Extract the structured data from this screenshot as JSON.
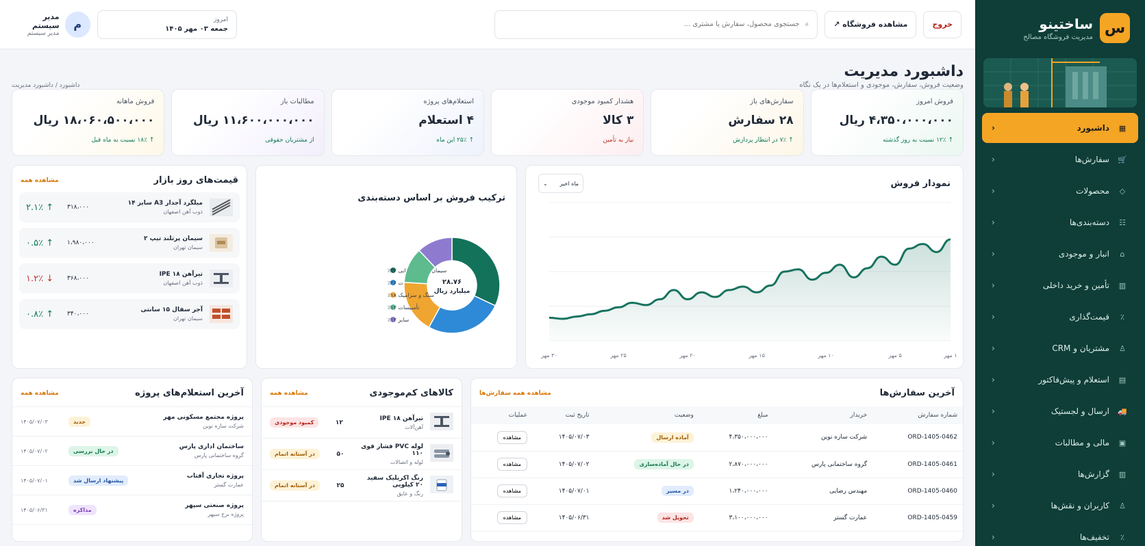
{
  "brand": {
    "logo": "س",
    "name": "ساختینو",
    "subtitle": "مدیریت فروشگاه مصالح"
  },
  "colors": {
    "primary": "#0f3d38",
    "accent": "#f5a524",
    "success": "#0f7a55",
    "danger": "#c0352b",
    "chart_line": "#17735f"
  },
  "nav": [
    {
      "label": "داشبورد",
      "icon": "grid-icon",
      "active": true
    },
    {
      "label": "سفارش‌ها",
      "icon": "cart-icon"
    },
    {
      "label": "محصولات",
      "icon": "box-icon"
    },
    {
      "label": "دسته‌بندی‌ها",
      "icon": "category-icon"
    },
    {
      "label": "انبار و موجودی",
      "icon": "warehouse-icon"
    },
    {
      "label": "تأمین و خرید داخلی",
      "icon": "supply-icon"
    },
    {
      "label": "قیمت‌گذاری",
      "icon": "percent-icon"
    },
    {
      "label": "مشتریان و CRM",
      "icon": "users-icon"
    },
    {
      "label": "استعلام و پیش‌فاکتور",
      "icon": "invoice-icon"
    },
    {
      "label": "ارسال و لجستیک",
      "icon": "truck-icon"
    },
    {
      "label": "مالی و مطالبات",
      "icon": "wallet-icon"
    },
    {
      "label": "گزارش‌ها",
      "icon": "report-icon"
    },
    {
      "label": "کاربران و نقش‌ها",
      "icon": "user-role-icon"
    },
    {
      "label": "تخفیف‌ها",
      "icon": "discount-icon"
    }
  ],
  "topbar": {
    "logout": "خروج",
    "view_store": "مشاهده فروشگاه ↗",
    "search_placeholder": "جستجوی محصول، سفارش یا مشتری ...",
    "date_label": "امروز",
    "date_value": "جمعه ۰۳ مهر ۱۴۰۵",
    "user_initial": "م",
    "user_name": "مدیر سیستم",
    "user_role": "مدیر سیستم"
  },
  "page": {
    "title": "داشبورد مدیریت",
    "subtitle": "وضعیت فروش، سفارش، موجودی و استعلام‌ها در یک نگاه",
    "breadcrumb": "داشبورد / داشبورد مدیریت"
  },
  "kpis": [
    {
      "title": "فروش امروز",
      "value": "۴،۳۵۰،۰۰۰،۰۰۰ ریال",
      "foot": "↑ ۱۲٪ نسبت به روز گذشته",
      "foot_color": "#0f7a55",
      "tint": "#eaf7f1"
    },
    {
      "title": "سفارش‌های باز",
      "value": "۲۸ سفارش",
      "foot": "↑ ۷٪ در انتظار پردازش",
      "foot_color": "#0f7a55",
      "tint": "#fdf6e6"
    },
    {
      "title": "هشدار کمبود موجودی",
      "value": "۳ کالا",
      "foot": "نیاز به تأمین",
      "foot_color": "#c0352b",
      "tint": "#fdeef0"
    },
    {
      "title": "استعلام‌های پروژه",
      "value": "۴ استعلام",
      "foot": "↑ ۲۵٪ این ماه",
      "foot_color": "#0f7a55",
      "tint": "#eef2fc"
    },
    {
      "title": "مطالبات باز",
      "value": "۱۱،۶۰۰،۰۰۰،۰۰۰ ریال",
      "foot": "از مشتریان حقوقی",
      "foot_color": "#0f7a55",
      "tint": "#f2eefc"
    },
    {
      "title": "فروش ماهانه",
      "value": "۱۸،۰۶۰،۵۰۰،۰۰۰ ریال",
      "foot": "↑ ۱۸٪ نسبت به ماه قبل",
      "foot_color": "#0f7a55",
      "tint": "#fdf8e8"
    }
  ],
  "sales_chart": {
    "title": "نمودار فروش",
    "period": "ماه اخیر"
  },
  "donut_card": {
    "title": "ترکیب فروش بر اساس دسته‌بندی",
    "center_value": "۲۸.۷۶",
    "center_unit": "میلیارد ریال"
  },
  "chart_data": [
    {
      "type": "area",
      "x": [
        "۱ مهر",
        "۲ مهر",
        "۳ مهر",
        "۴ مهر",
        "۵ مهر",
        "۶ مهر",
        "۷ مهر",
        "۸ مهر",
        "۹ مهر",
        "۱۰ مهر",
        "۱۱ مهر",
        "۱۲ مهر",
        "۱۳ مهر",
        "۱۴ مهر",
        "۱۵ مهر",
        "۱۶ مهر",
        "۱۷ مهر",
        "۱۸ مهر",
        "۱۹ مهر",
        "۲۰ مهر",
        "۲۱ مهر",
        "۲۲ مهر",
        "۲۳ مهر",
        "۲۴ مهر",
        "۲۵ مهر",
        "۲۶ مهر",
        "۲۷ مهر",
        "۲۸ مهر",
        "۲۹ مهر",
        "۳۰ مهر"
      ],
      "xticks": [
        "۱ مهر",
        "۵ مهر",
        "۱۰ مهر",
        "۱۵ مهر",
        "۲۰ مهر",
        "۲۵ مهر",
        "۳۰ مهر"
      ],
      "values": [
        6.8,
        5.7,
        6.4,
        6.0,
        4.6,
        5.3,
        4.3,
        3.5,
        4.6,
        3.9,
        3.3,
        4.2,
        4.0,
        2.8,
        2.2,
        2.7,
        2.4,
        1.8,
        2.2,
        1.6,
        2.4,
        1.6,
        1.1,
        1.3,
        0.9,
        0.6,
        0.3,
        0.1,
        -0.1,
        0.0
      ],
      "ylim": [
        -2,
        10
      ],
      "grid": true
    },
    {
      "type": "pie",
      "legend": [
        {
          "label": "سیمان و مصالح بنایی ۳۲٪",
          "value": 32,
          "color": "#13725a"
        },
        {
          "label": "آهن‌آلات ۲۶٪",
          "value": 26,
          "color": "#2e8ad6"
        },
        {
          "label": "سنگ و سرامیک ۱۸٪",
          "value": 18,
          "color": "#f0a530"
        },
        {
          "label": "تأسیسات ۱۲٪",
          "value": 12,
          "color": "#5dbb8e"
        },
        {
          "label": "سایر ۱۲٪",
          "value": 12,
          "color": "#8e7bd0"
        }
      ],
      "legend_position": "left"
    }
  ],
  "market": {
    "title": "قیمت‌های روز بازار",
    "link": "مشاهده همه",
    "items": [
      {
        "name": "میلگرد آجدار A3 سایز ۱۴",
        "supplier": "ذوب آهن اصفهان",
        "price": "۳۱۸،۰۰۰",
        "change": "↑ ۲.۱٪",
        "color": "#0f7a55",
        "thumb": "rebar-icon"
      },
      {
        "name": "سیمان پرتلند تیپ ۲",
        "supplier": "سیمان تهران",
        "price": "۱،۹۸۰،۰۰۰",
        "change": "↑ ۰.۵٪",
        "color": "#0f7a55",
        "thumb": "cement-bag-icon"
      },
      {
        "name": "تیرآهن IPE ۱۸",
        "supplier": "ذوب آهن اصفهان",
        "price": "۳۶۸،۰۰۰",
        "change": "↓ ۱.۲٪",
        "color": "#c0352b",
        "thumb": "beam-icon"
      },
      {
        "name": "آجر سفال ۱۵ سانتی",
        "supplier": "سیمان تهران",
        "price": "۳۴۰،۰۰۰",
        "change": "↑ ۰.۸٪",
        "color": "#0f7a55",
        "thumb": "brick-icon"
      }
    ]
  },
  "orders": {
    "title": "آخرین سفارش‌ها",
    "link": "مشاهده همه سفارش‌ها",
    "columns": [
      "شماره سفارش",
      "خریدار",
      "مبلغ",
      "وضعیت",
      "تاریخ ثبت",
      "عملیات"
    ],
    "rows": [
      {
        "id": "ORD-1405-0462",
        "buyer": "شرکت سازه نوین",
        "amount": "۴،۳۵۰،۰۰۰،۰۰۰",
        "status": "آماده ارسال",
        "sbg": "#fdf2d6",
        "sfg": "#a15c07",
        "date": "۱۴۰۵/۰۷/۰۳",
        "action": "مشاهده"
      },
      {
        "id": "ORD-1405-0461",
        "buyer": "گروه ساختمانی پارس",
        "amount": "۲،۸۷۰،۰۰۰،۰۰۰",
        "status": "در حال آماده‌سازی",
        "sbg": "#dcf5e7",
        "sfg": "#14774b",
        "date": "۱۴۰۵/۰۷/۰۲",
        "action": "مشاهده"
      },
      {
        "id": "ORD-1405-0460",
        "buyer": "مهندس رضایی",
        "amount": "۱،۲۴۰،۰۰۰،۰۰۰",
        "status": "در مسیر",
        "sbg": "#e1ecfc",
        "sfg": "#2456a6",
        "date": "۱۴۰۵/۰۷/۰۱",
        "action": "مشاهده"
      },
      {
        "id": "ORD-1405-0459",
        "buyer": "عمارت گستر",
        "amount": "۳،۱۰۰،۰۰۰،۰۰۰",
        "status": "تحویل شد",
        "sbg": "#fde4e4",
        "sfg": "#b42318",
        "date": "۱۴۰۵/۰۶/۳۱",
        "action": "مشاهده"
      }
    ]
  },
  "lowstock": {
    "title": "کالاهای کم‌موجودی",
    "link": "مشاهده همه",
    "items": [
      {
        "name": "تیرآهن IPE ۱۸",
        "cat": "آهن‌آلات",
        "qty": "۱۲",
        "status": "کمبود موجودی",
        "sbg": "#fde4e4",
        "sfg": "#b42318",
        "thumb": "beam-icon"
      },
      {
        "name": "لوله PVC فشار قوی ۱۱۰",
        "cat": "لوله و اتصالات",
        "qty": "۵۰",
        "status": "در آستانه اتمام",
        "sbg": "#fdf2d6",
        "sfg": "#a15c07",
        "thumb": "pipe-icon"
      },
      {
        "name": "رنگ اکریلیک سفید ۲۰ کیلویی",
        "cat": "رنگ و عایق",
        "qty": "۲۵",
        "status": "در آستانه اتمام",
        "sbg": "#fdf2d6",
        "sfg": "#a15c07",
        "thumb": "paint-bucket-icon"
      }
    ]
  },
  "inquiries": {
    "title": "آخرین استعلام‌های پروژه",
    "link": "مشاهده همه",
    "items": [
      {
        "name": "پروژه مجتمع مسکونی مهر",
        "company": "شرکت سازه نوین",
        "status": "جدید",
        "sbg": "#fdf2d6",
        "sfg": "#a15c07",
        "date": "۱۴۰۵/۰۷/۰۳"
      },
      {
        "name": "ساختمان اداری پارس",
        "company": "گروه ساختمانی پارس",
        "status": "در حال بررسی",
        "sbg": "#dcf5e7",
        "sfg": "#14774b",
        "date": "۱۴۰۵/۰۷/۰۲"
      },
      {
        "name": "پروژه تجاری آفتاب",
        "company": "عمارت گستر",
        "status": "پیشنهاد ارسال شد",
        "sbg": "#e1ecfc",
        "sfg": "#2456a6",
        "date": "۱۴۰۵/۰۷/۰۱"
      },
      {
        "name": "پروژه صنعتی سپهر",
        "company": "پروژه برج سپهر",
        "status": "مذاکره",
        "sbg": "#efe4fb",
        "sfg": "#7a3db8",
        "date": "۱۴۰۵/۰۶/۳۱"
      }
    ]
  }
}
